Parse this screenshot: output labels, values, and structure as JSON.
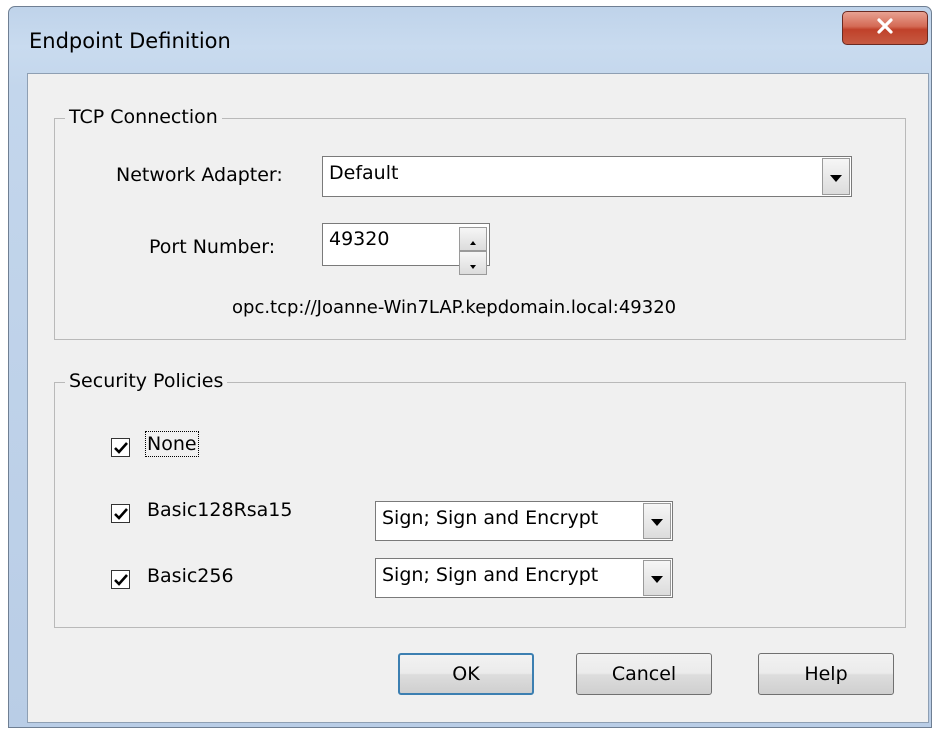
{
  "window": {
    "title": "Endpoint Definition"
  },
  "tcp": {
    "group_label": "TCP Connection",
    "network_adapter_label": "Network Adapter:",
    "network_adapter_value": "Default",
    "port_label": "Port Number:",
    "port_value": "49320",
    "endpoint_url": "opc.tcp://Joanne-Win7LAP.kepdomain.local:49320"
  },
  "security": {
    "group_label": "Security Policies",
    "policies": [
      {
        "name": "None",
        "checked": true
      },
      {
        "name": "Basic128Rsa15",
        "checked": true,
        "mode": "Sign; Sign and Encrypt"
      },
      {
        "name": "Basic256",
        "checked": true,
        "mode": "Sign; Sign and Encrypt"
      }
    ]
  },
  "buttons": {
    "ok": "OK",
    "cancel": "Cancel",
    "help": "Help"
  },
  "icons": {
    "close": "close-icon",
    "dropdown": "chevron-down-icon",
    "check": "checkmark-icon",
    "spin_up": "spin-up-icon",
    "spin_down": "spin-down-icon"
  },
  "colors": {
    "title_bar": "#c6d8ee",
    "close_button": "#c9503a",
    "client": "#f0f0f0"
  }
}
